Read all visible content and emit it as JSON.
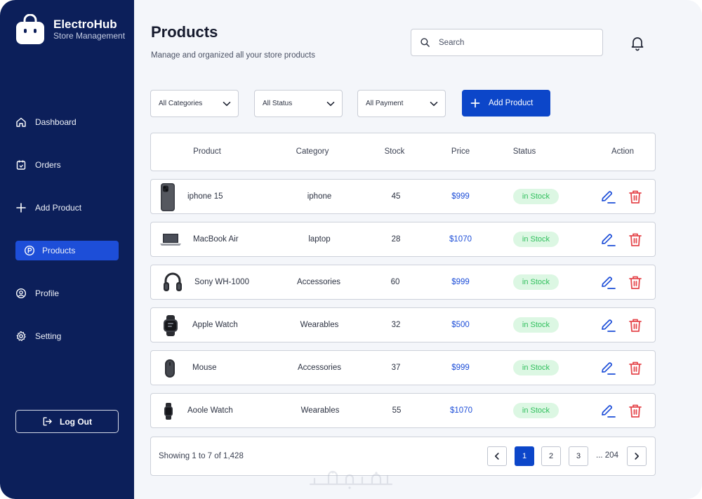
{
  "brand": {
    "name": "ElectroHub",
    "subtitle": "Store Management"
  },
  "nav": [
    {
      "label": "Dashboard",
      "icon": "home-icon"
    },
    {
      "label": "Orders",
      "icon": "orders-icon"
    },
    {
      "label": "Add Product",
      "icon": "plus-icon"
    },
    {
      "label": "Products",
      "icon": "products-icon",
      "active": true
    },
    {
      "label": "Profile",
      "icon": "user-icon"
    },
    {
      "label": "Setting",
      "icon": "gear-icon"
    }
  ],
  "logout_label": "Log Out",
  "page": {
    "title": "Products",
    "subtitle": "Manage and organized all your store products"
  },
  "search": {
    "placeholder": "Search",
    "value": ""
  },
  "filters": {
    "category": "All Categories",
    "status": "All Status",
    "payment": "All Payment"
  },
  "add_product_label": "Add Product",
  "table": {
    "headers": [
      "Product",
      "Category",
      "Stock",
      "Price",
      "Status",
      "Action"
    ],
    "rows": [
      {
        "product": "iphone 15",
        "category": "iphone",
        "stock": "45",
        "price": "$999",
        "status": "in Stock",
        "image": "phone-image"
      },
      {
        "product": "MacBook Air",
        "category": "laptop",
        "stock": "28",
        "price": "$1070",
        "status": "in Stock",
        "image": "laptop-image"
      },
      {
        "product": "Sony WH-1000",
        "category": "Accessories",
        "stock": "60",
        "price": "$999",
        "status": "in Stock",
        "image": "headphones-image"
      },
      {
        "product": "Apple Watch",
        "category": "Wearables",
        "stock": "32",
        "price": "$500",
        "status": "in Stock",
        "image": "watch-image"
      },
      {
        "product": "Mouse",
        "category": "Accessories",
        "stock": "37",
        "price": "$999",
        "status": "in Stock",
        "image": "mouse-image"
      },
      {
        "product": "Aoole Watch",
        "category": "Wearables",
        "stock": "55",
        "price": "$1070",
        "status": "in Stock",
        "image": "watch-image"
      }
    ]
  },
  "pagination": {
    "showing": "Showing 1 to 7 of 1,428",
    "pages": [
      "1",
      "2",
      "3"
    ],
    "current": "1",
    "ellipsis": "... 204"
  },
  "colors": {
    "sidebar": "#0c1f5a",
    "accent": "#0c46c9",
    "price": "#1d4ed8",
    "stock_badge_bg": "#dcf7e3",
    "stock_badge_text": "#2fbf5c",
    "delete": "#e5484d"
  }
}
